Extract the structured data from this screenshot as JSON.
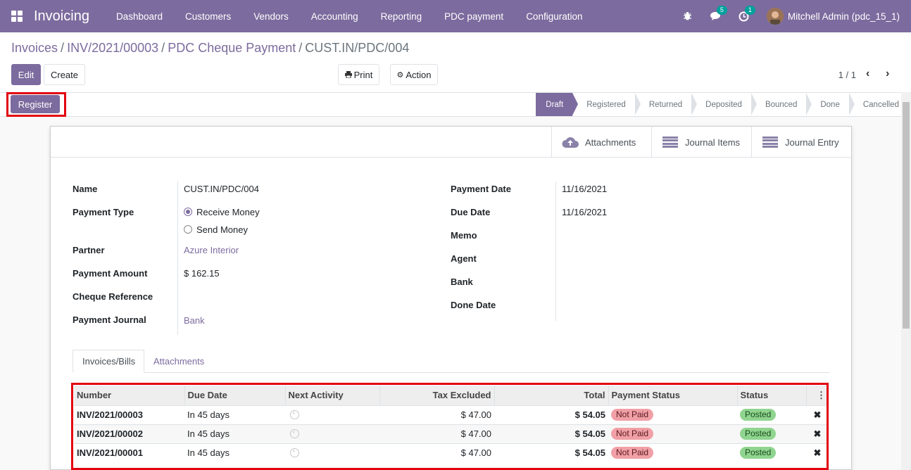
{
  "navbar": {
    "app_name": "Invoicing",
    "menu": [
      "Dashboard",
      "Customers",
      "Vendors",
      "Accounting",
      "Reporting",
      "PDC payment",
      "Configuration"
    ],
    "messages_count": "5",
    "activities_count": "1",
    "user": "Mitchell Admin (pdc_15_1)"
  },
  "breadcrumb": [
    "Invoices",
    "INV/2021/00003",
    "PDC Cheque Payment",
    "CUST.IN/PDC/004"
  ],
  "buttons": {
    "edit": "Edit",
    "create": "Create",
    "print": "Print",
    "action": "Action",
    "register": "Register"
  },
  "pager": "1 / 1",
  "stages": [
    "Draft",
    "Registered",
    "Returned",
    "Deposited",
    "Bounced",
    "Done",
    "Cancelled"
  ],
  "active_stage": "Draft",
  "smart_buttons": {
    "attachments": "Attachments",
    "journal_items": "Journal Items",
    "journal_entry": "Journal Entry"
  },
  "form": {
    "left": {
      "name_label": "Name",
      "name_value": "CUST.IN/PDC/004",
      "payment_type_label": "Payment Type",
      "payment_type_options": [
        "Receive Money",
        "Send Money"
      ],
      "payment_type_selected": "Receive Money",
      "partner_label": "Partner",
      "partner_value": "Azure Interior",
      "amount_label": "Payment Amount",
      "amount_value": "$ 162.15",
      "cheque_label": "Cheque Reference",
      "journal_label": "Payment Journal",
      "journal_value": "Bank"
    },
    "right": {
      "payment_date_label": "Payment Date",
      "payment_date_value": "11/16/2021",
      "due_date_label": "Due Date",
      "due_date_value": "11/16/2021",
      "memo_label": "Memo",
      "agent_label": "Agent",
      "bank_label": "Bank",
      "done_date_label": "Done Date"
    }
  },
  "tabs": [
    "Invoices/Bills",
    "Attachments"
  ],
  "table": {
    "headers": [
      "Number",
      "Due Date",
      "Next Activity",
      "Tax Excluded",
      "Total",
      "Payment Status",
      "Status"
    ],
    "rows": [
      {
        "number": "INV/2021/00003",
        "due": "In 45 days",
        "tax_excl": "$ 47.00",
        "total": "$ 54.05",
        "payment_status": "Not Paid",
        "status": "Posted"
      },
      {
        "number": "INV/2021/00002",
        "due": "In 45 days",
        "tax_excl": "$ 47.00",
        "total": "$ 54.05",
        "payment_status": "Not Paid",
        "status": "Posted"
      },
      {
        "number": "INV/2021/00001",
        "due": "In 45 days",
        "tax_excl": "$ 47.00",
        "total": "$ 54.05",
        "payment_status": "Not Paid",
        "status": "Posted"
      }
    ]
  },
  "colors": {
    "brand": "#7c6b9e",
    "highlight": "#e2000f",
    "not_paid": "#f0a0a6",
    "posted": "#8fd48f"
  }
}
